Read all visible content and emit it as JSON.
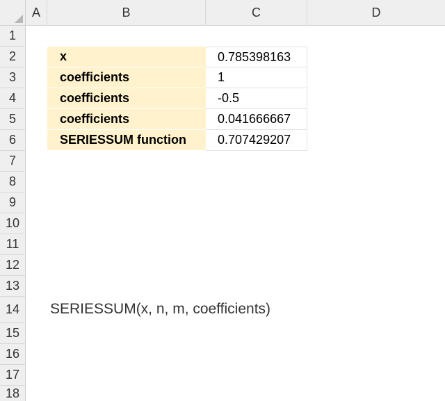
{
  "columns": [
    "A",
    "B",
    "C",
    "D"
  ],
  "rows": [
    "1",
    "2",
    "3",
    "4",
    "5",
    "6",
    "7",
    "8",
    "9",
    "10",
    "11",
    "12",
    "13",
    "14",
    "15",
    "16",
    "17",
    "18"
  ],
  "table": [
    {
      "label": "x",
      "value": "0.785398163"
    },
    {
      "label": "coefficients",
      "value": "1"
    },
    {
      "label": "coefficients",
      "value": "-0.5"
    },
    {
      "label": "coefficients",
      "value": "0.041666667"
    },
    {
      "label": "SERIESSUM function",
      "value": "0.707429207"
    }
  ],
  "syntax_text": "SERIESSUM(x, n, m, coefficients)"
}
